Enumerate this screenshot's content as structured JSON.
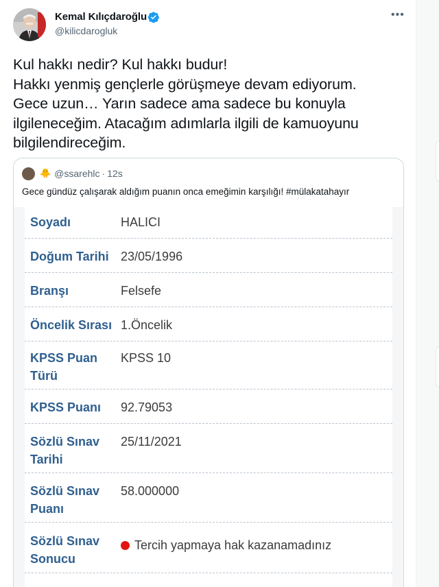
{
  "author": {
    "name": "Kemal Kılıçdaroğlu",
    "handle": "@kilicdarogluk",
    "verified": true,
    "accent_color": "#1d9bf0"
  },
  "more_icon": "more-horizontal-icon",
  "tweet_lines": [
    "Kul hakkı nedir? Kul hakkı budur!",
    "Hakkı yenmiş gençlerle görüşmeye devam ediyorum.",
    "Gece uzun… Yarın sadece ama sadece bu konuyla",
    "ilgileneceğim. Atacağım adımlarla ilgili de kamuoyunu",
    "bilgilendireceğim."
  ],
  "quote": {
    "emoji": "🐥",
    "handle": "@ssarehlc",
    "separator": "·",
    "time": "12s",
    "text": "Gece gündüz çalışarak aldığım puanın onca emeğimin karşılığı!  #mülakatahayır",
    "rows": [
      {
        "label": "Soyadı",
        "value": "HALICI"
      },
      {
        "label": "Doğum Tarihi",
        "value": "23/05/1996"
      },
      {
        "label": "Branşı",
        "value": "Felsefe"
      },
      {
        "label": "Öncelik Sırası",
        "value": "1.Öncelik"
      },
      {
        "label": "KPSS Puan Türü",
        "value": "KPSS 10"
      },
      {
        "label": "KPSS Puanı",
        "value": "92.79053"
      },
      {
        "label": "Sözlü Sınav Tarihi",
        "value": "25/11/2021"
      },
      {
        "label": "Sözlü Sınav Puanı",
        "value": "58.000000"
      },
      {
        "label": "Sözlü Sınav Sonucu",
        "value": "Tercih yapmaya hak kazanamadınız",
        "status_color": "#e3130f"
      }
    ]
  }
}
